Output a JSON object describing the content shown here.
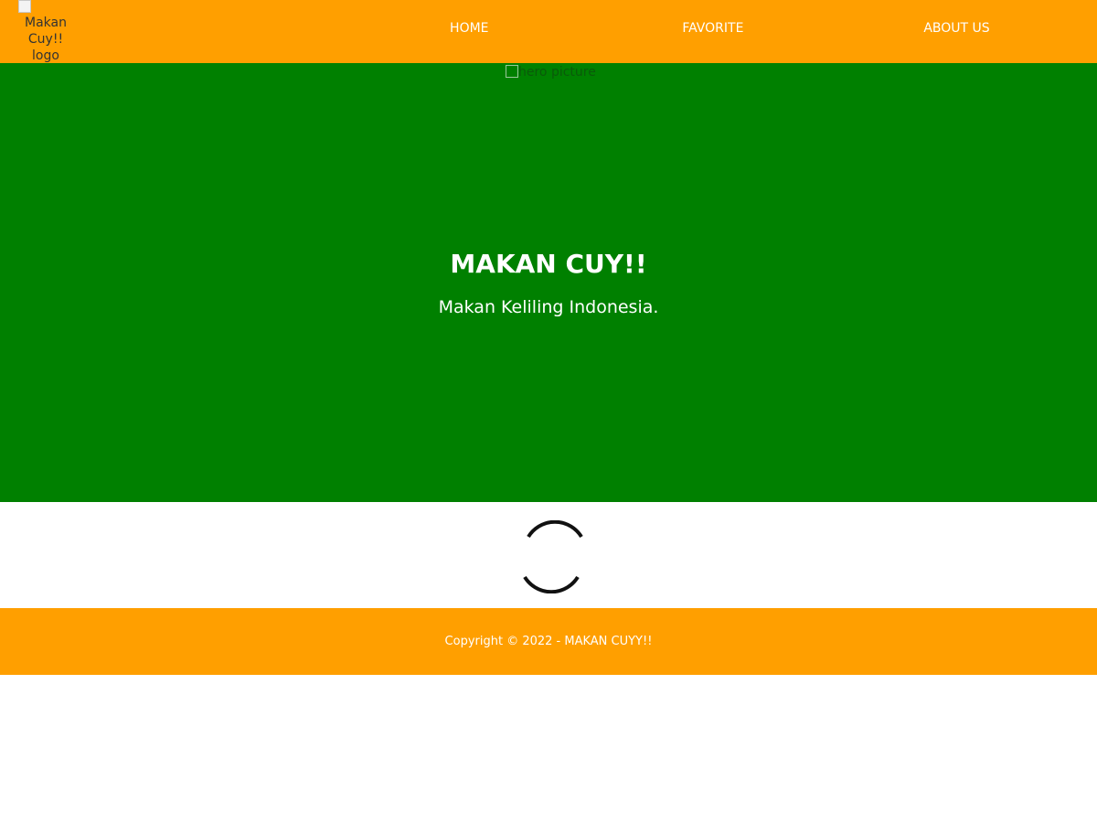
{
  "header": {
    "logo_alt": "Makan Cuy!! logo",
    "nav": [
      {
        "label": "HOME"
      },
      {
        "label": "FAVORITE"
      },
      {
        "label": "ABOUT US"
      }
    ]
  },
  "hero": {
    "image_alt": "hero picture",
    "title": "MAKAN CUY!!",
    "tagline": "Makan Keliling Indonesia."
  },
  "content": {
    "loading_icon": "loading-spinner-icon"
  },
  "footer": {
    "copyright": "Copyright © 2022 - MAKAN CUYY!!"
  },
  "colors": {
    "app_bar": "#ff9f00",
    "hero_bg": "#008000",
    "footer_bg": "#ff9f00",
    "text_light": "#ffffff"
  }
}
